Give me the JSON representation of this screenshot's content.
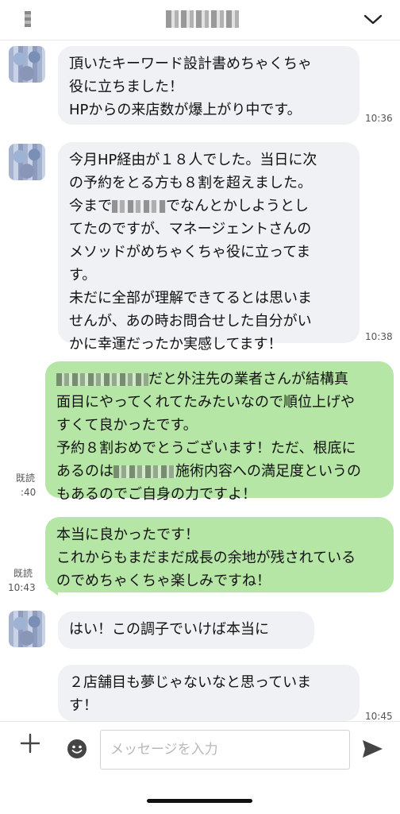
{
  "header": {
    "title_redacted": "",
    "chevron_icon": "chevron-down-icon"
  },
  "messages": [
    {
      "id": "m1",
      "side": "in",
      "text": "頂いたキーワード設計書めちゃくちゃ\n役に立ちました！\nHPからの来店数が爆上がり中です。",
      "time": "10:36"
    },
    {
      "id": "m2",
      "side": "in",
      "text_before": "今月HP経由が１８人でした。当日に次\nの予約をとる方も８割を超えました。\n今まで",
      "text_after": "でなんとかしようとし\nてたのですが、マネージェントさんの\nメソッドがめちゃくちゃ役に立ってま\nす。\n未だに全部が理解できてるとは思いま\nせんが、あの時お問合せした自分がい\nかに幸運だったか実感してます！",
      "time": "10:38"
    },
    {
      "id": "m3",
      "side": "out",
      "text_before": "",
      "text_mid": "だと外注先の業者さんが結構真\n面目にやってくれてたみたいなので順位上げや\nすくて良かったです。\n予約８割おめでとうございます！ただ、根底に\nあるのは",
      "text_after": "施術内容への満足度というの\nもあるのでご自身の力ですよ！",
      "read": "既読",
      "time": ":40"
    },
    {
      "id": "m4",
      "side": "out",
      "text": "本当に良かったです！\nこれからもまだまだ成長の余地が残されている\nのでめちゃくちゃ楽しみですね！",
      "read": "既読",
      "time": "10:43"
    },
    {
      "id": "m5",
      "side": "in",
      "text": "はい！この調子でいけば本当に"
    },
    {
      "id": "m6",
      "side": "in",
      "text": "２店舗目も夢じゃないなと思っていま\nす！",
      "time": "10:45"
    }
  ],
  "composer": {
    "placeholder": "メッセージを入力",
    "plus_icon": "plus-icon",
    "emoji_icon": "emoji-icon",
    "send_icon": "send-icon"
  }
}
